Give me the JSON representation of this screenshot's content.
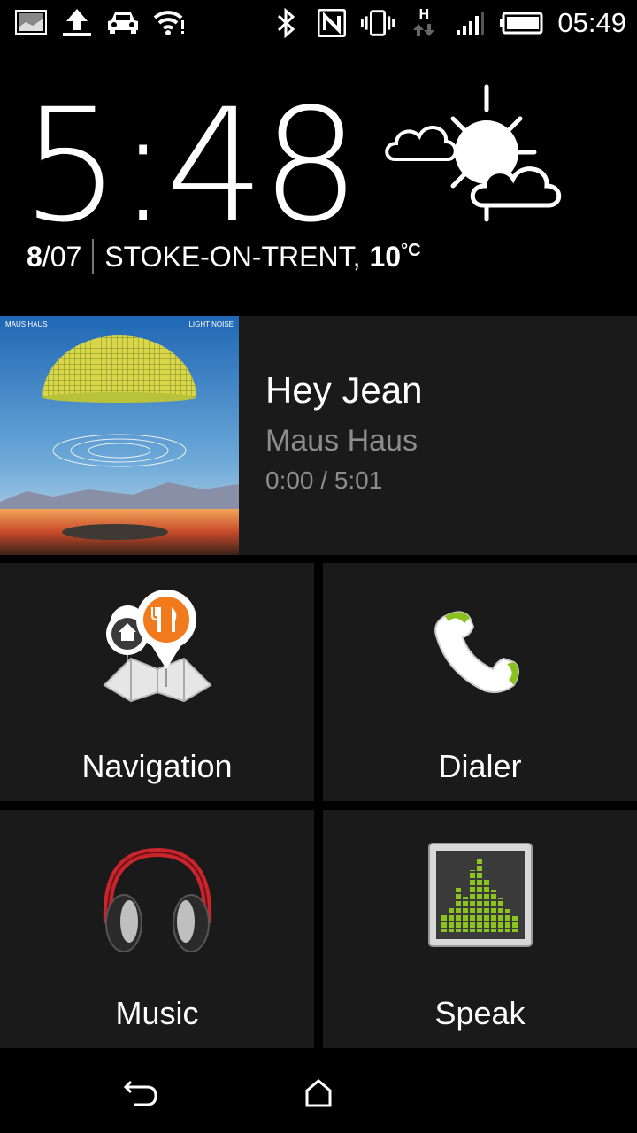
{
  "status_bar": {
    "time": "05:49",
    "left_icons": [
      "gallery-icon",
      "upload-icon",
      "car-icon",
      "wifi-icon"
    ],
    "right_icons": [
      "bluetooth-icon",
      "nfc-icon",
      "vibrate-icon",
      "network-h-icon",
      "signal-icon",
      "battery-icon"
    ],
    "network_label": "H"
  },
  "clock": {
    "time": "5:48",
    "date_day": "8",
    "date_rest": "/07",
    "location": "STOKE-ON-TRENT,",
    "temperature": "10",
    "temp_unit": "°C",
    "weather_icon": "partly-cloudy-icon"
  },
  "now_playing": {
    "title": "Hey Jean",
    "artist": "Maus Haus",
    "progress": "0:00 / 5:01",
    "album_art_text_left": "MAUS HAUS",
    "album_art_text_right": "LIGHT NOISE"
  },
  "tiles": [
    {
      "label": "Navigation",
      "icon": "navigation-map-icon"
    },
    {
      "label": "Dialer",
      "icon": "phone-handset-icon"
    },
    {
      "label": "Music",
      "icon": "headphones-icon"
    },
    {
      "label": "Speak",
      "icon": "voice-equalizer-icon"
    }
  ],
  "nav_bar": {
    "buttons": [
      "back-icon",
      "home-icon"
    ]
  }
}
